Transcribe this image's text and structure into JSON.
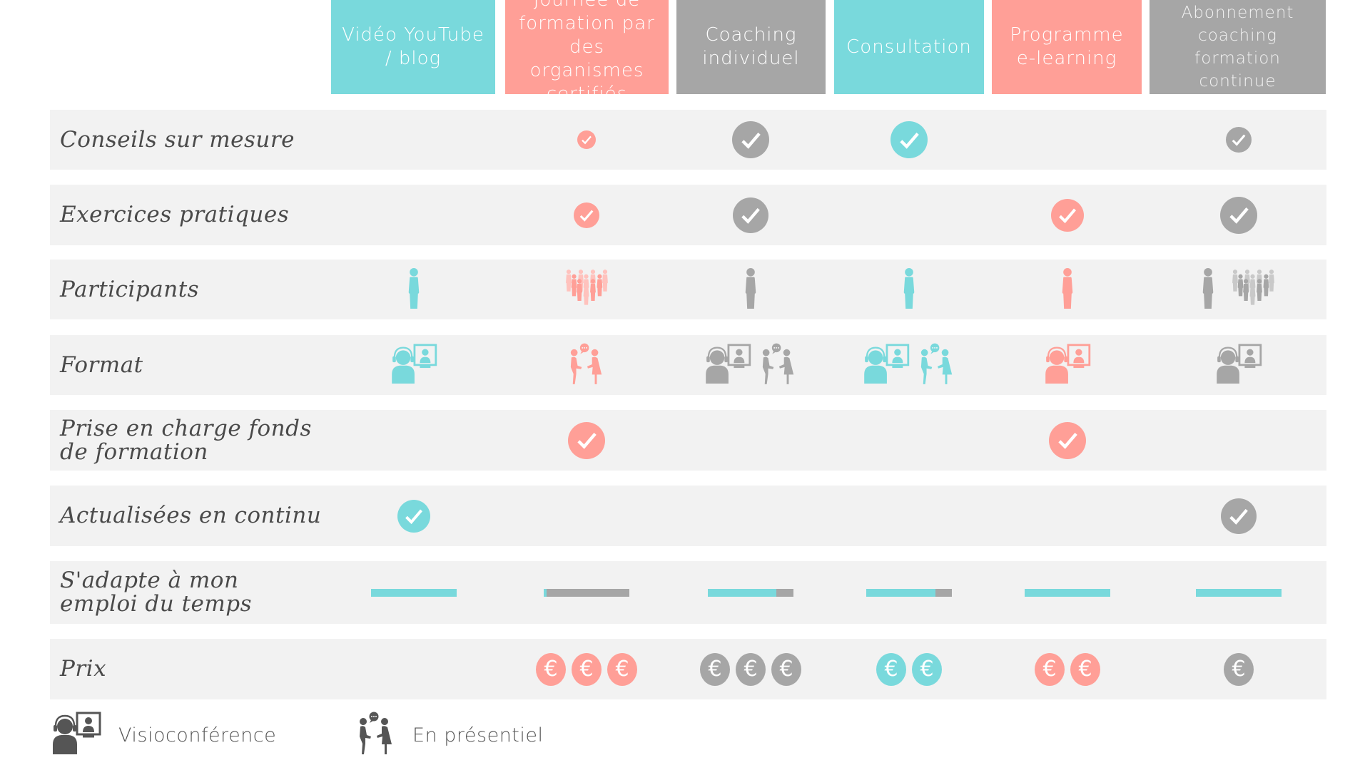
{
  "colors": {
    "teal": "#79d9dc",
    "salmon": "#ff9f97",
    "salmon_light": "#ffc2bd",
    "gray": "#a6a6a6",
    "gray_light": "#c9c9c9",
    "row_bg": "#f2f2f2",
    "text_dark": "#4a4a4a",
    "legend_icon": "#555555"
  },
  "columns": [
    {
      "label": "Vidéo YouTube\n/ blog",
      "color": "teal"
    },
    {
      "label": "Journée de\nformation par\ndes organismes\ncertifiés",
      "color": "salmon"
    },
    {
      "label": "Coaching\nindividuel",
      "color": "gray"
    },
    {
      "label": "Consultation",
      "color": "teal"
    },
    {
      "label": "Programme\ne-learning",
      "color": "salmon"
    },
    {
      "label": "Abonnement\ncoaching\nformation continue",
      "color": "gray"
    }
  ],
  "rows": {
    "conseils": {
      "label": "Conseils sur mesure",
      "values": [
        false,
        true,
        true,
        true,
        false,
        true
      ]
    },
    "exercices": {
      "label": "Exercices pratiques",
      "values": [
        false,
        true,
        true,
        false,
        true,
        true
      ]
    },
    "participants": {
      "label": "Participants",
      "values": [
        "single",
        "group",
        "single",
        "single",
        "single",
        "single+group"
      ]
    },
    "format": {
      "label": "Format",
      "values": [
        [
          "visio"
        ],
        [
          "presentiel"
        ],
        [
          "visio",
          "presentiel"
        ],
        [
          "visio",
          "presentiel"
        ],
        [
          "visio"
        ],
        [
          "visio"
        ]
      ]
    },
    "fonds": {
      "label": "Prise en charge fonds\nde formation",
      "values": [
        false,
        true,
        false,
        false,
        true,
        false
      ]
    },
    "actualisees": {
      "label": "Actualisées en continu",
      "values": [
        true,
        false,
        false,
        false,
        false,
        true
      ]
    },
    "emploi": {
      "label": "S'adapte à mon\nemploi du temps",
      "flexibility_percent": [
        100,
        3,
        80,
        81,
        100,
        100
      ]
    },
    "prix": {
      "label": "Prix",
      "euro_count": [
        0,
        3,
        3,
        2,
        2,
        1
      ],
      "symbol": "€"
    }
  },
  "legend": [
    {
      "icon": "visio-icon",
      "label": "Visioconférence"
    },
    {
      "icon": "presentiel-icon",
      "label": "En présentiel"
    }
  ]
}
